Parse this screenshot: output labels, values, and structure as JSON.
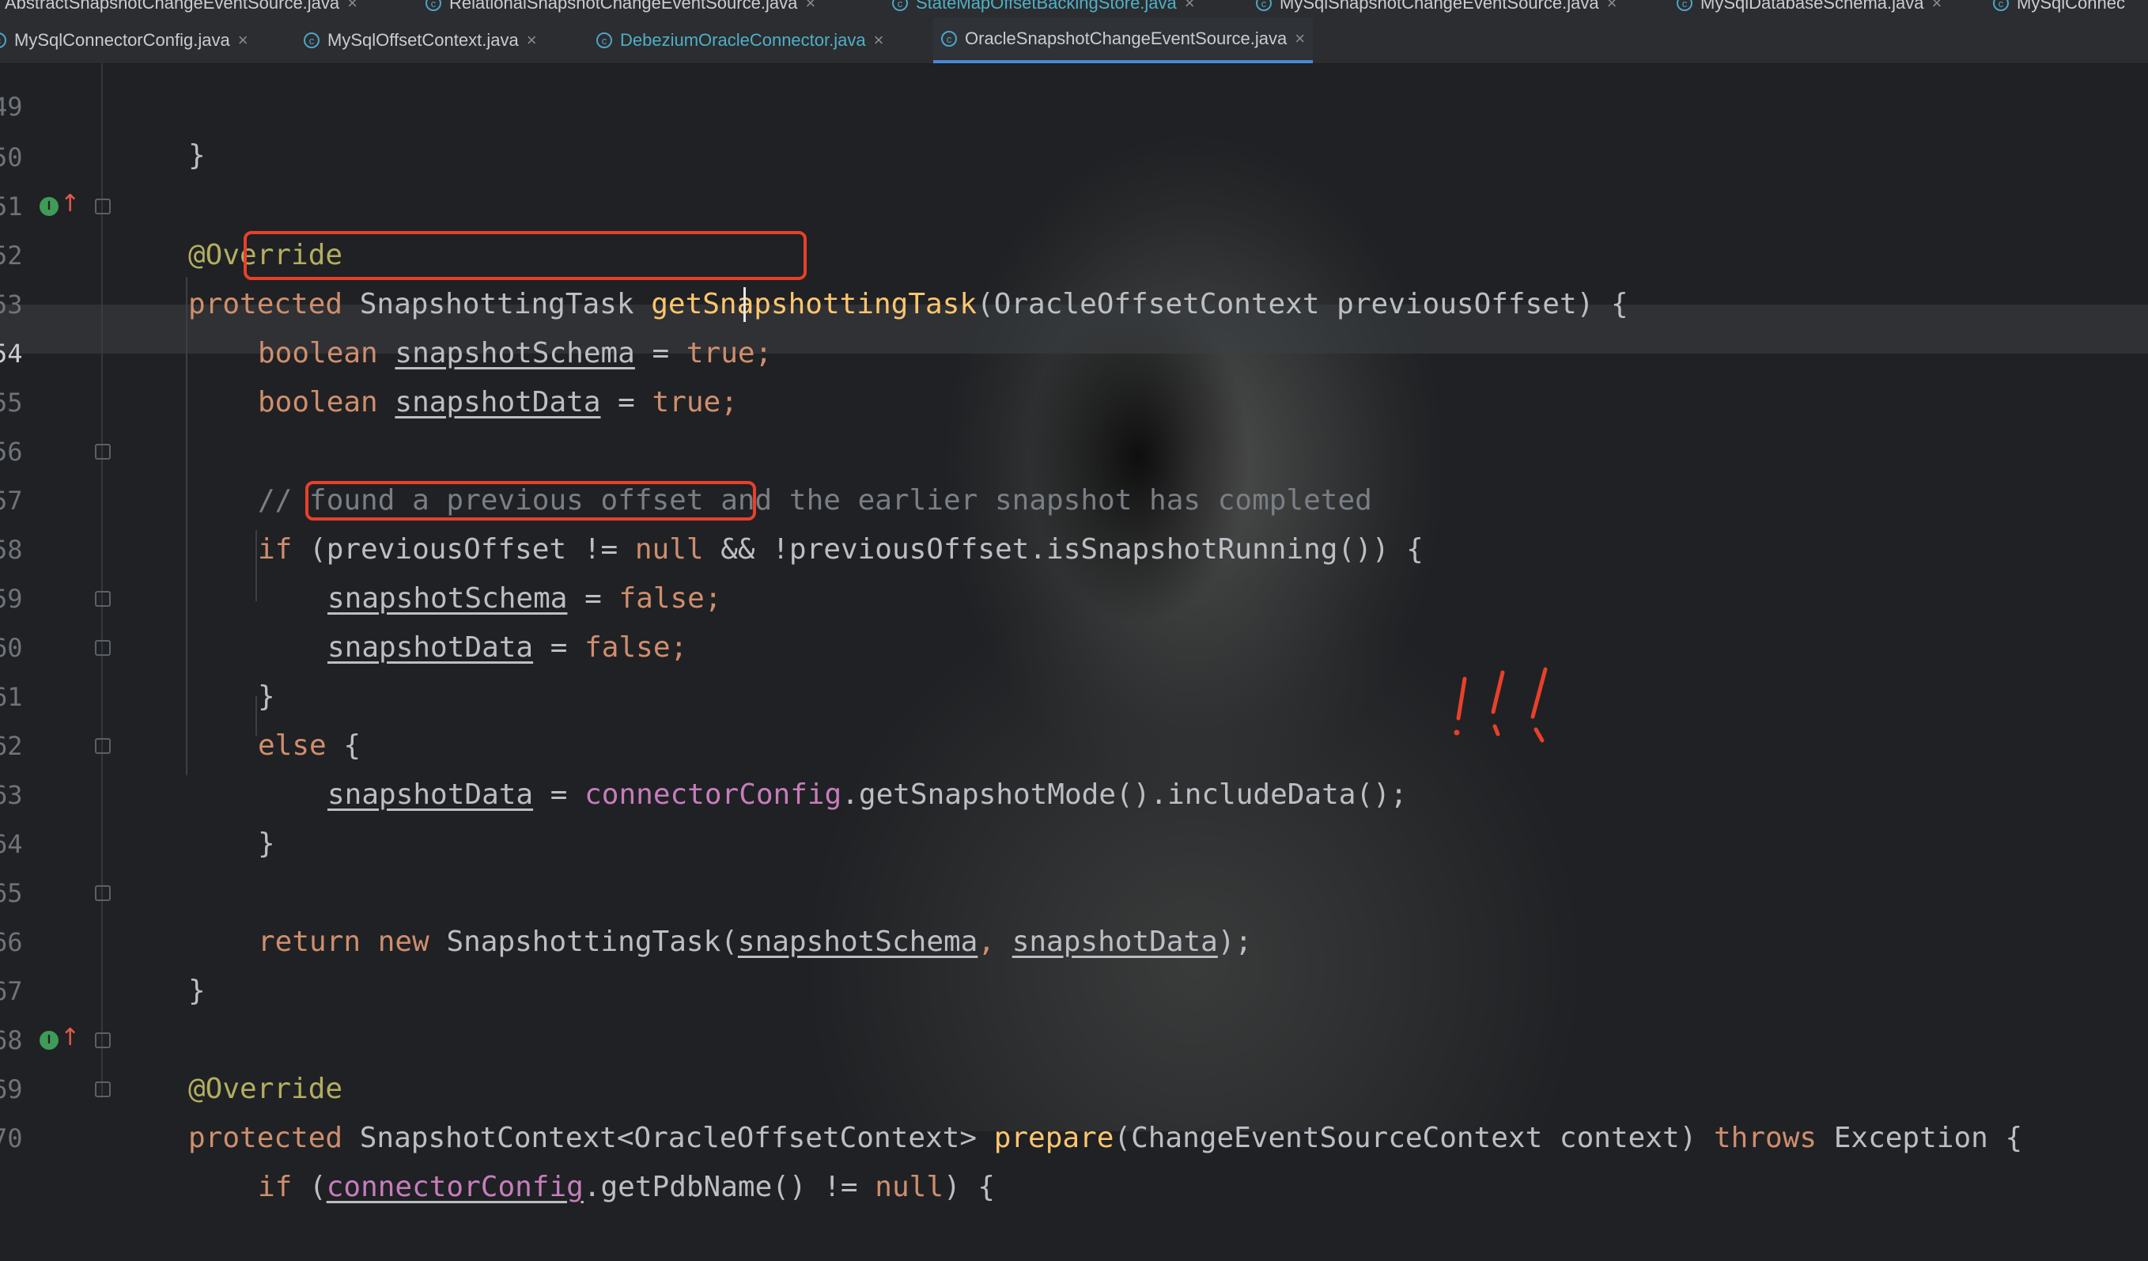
{
  "top_tabs": [
    {
      "label": "AbstractSnapshotChangeEventSource.java"
    },
    {
      "label": "RelationalSnapshotChangeEventSource.java"
    },
    {
      "label": "StateMapOffsetBackingStore.java"
    },
    {
      "label": "MySqlSnapshotChangeEventSource.java"
    },
    {
      "label": "MySqlDatabaseSchema.java"
    },
    {
      "label": "MySqlConnec"
    }
  ],
  "tabs": [
    {
      "label": "MySqlConnectorConfig.java"
    },
    {
      "label": "MySqlOffsetContext.java"
    },
    {
      "label": "DebeziumOracleConnector.java"
    },
    {
      "label": "OracleSnapshotChangeEventSource.java"
    }
  ],
  "line_numbers": [
    "49",
    "50",
    "51",
    "52",
    "53",
    "54",
    "55",
    "56",
    "57",
    "58",
    "59",
    "60",
    "61",
    "62",
    "63",
    "64",
    "65",
    "66",
    "67",
    "68",
    "69",
    "70"
  ],
  "code": {
    "l49": "}",
    "l51": "@Override",
    "l52": [
      "protected",
      " SnapshottingTask ",
      "getSnapshottingTask",
      "(OracleOffsetContext previousOffset) {"
    ],
    "l53": [
      "boolean",
      " ",
      "snapshotSchema",
      " = ",
      "true;"
    ],
    "l54": [
      "boolean",
      " ",
      "snapshotData",
      " = ",
      "true;"
    ],
    "l56": "// found a previous offset and the earlier snapshot has completed",
    "l57": [
      "if",
      " (previousOffset != ",
      "null",
      " && !previousOffset.isSnapshotRunning()) {"
    ],
    "l58": [
      "snapshotSchema",
      " = ",
      "false;"
    ],
    "l59": [
      "snapshotData",
      " = ",
      "false;"
    ],
    "l60": "}",
    "l61": [
      "else",
      " {"
    ],
    "l62": [
      "snapshotData",
      " = ",
      "connectorConfig",
      ".getSnapshotMode().includeData();"
    ],
    "l63": "}",
    "l65": [
      "return",
      " ",
      "new",
      " SnapshottingTask(",
      "snapshotSchema",
      ", ",
      "snapshotData",
      ");"
    ],
    "l66": "}",
    "l68": "@Override",
    "l69": [
      "protected",
      " SnapshotContext<OracleOffsetContext> ",
      "prepare",
      "(ChangeEventSourceContext context) ",
      "throws",
      " Exception {"
    ],
    "l70": [
      "if",
      " (",
      "connectorConfig",
      ".getPdbName() != ",
      "null",
      ") {"
    ]
  },
  "annotation_marks": "! ! !",
  "colors": {
    "background": "#1f2124",
    "keyword": "#cf8e6d",
    "annotation": "#b3ae60",
    "method_decl": "#ffc66d",
    "field": "#c77dbb",
    "comment": "#7a7e85",
    "highlight_box": "#e8402a",
    "active_tab_underline": "#4a88d6"
  },
  "icons": {
    "tab_class_icon": "class-c-icon",
    "tab_close": "close-icon",
    "gutter_implements": "implements-icon",
    "gutter_override_up": "override-up-arrow-icon",
    "fold": "fold-marker-icon"
  }
}
